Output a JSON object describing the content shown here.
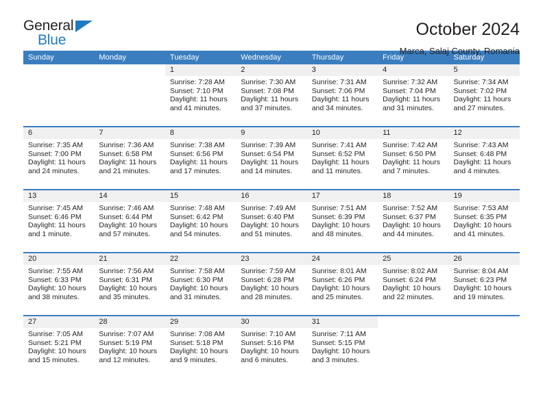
{
  "logo": {
    "word_one": "General",
    "word_two": "Blue",
    "triangle_icon": "blue-triangle-icon",
    "blue": "#1f7ac4"
  },
  "header": {
    "title": "October 2024",
    "subtitle": "Marca, Salaj County, Romania"
  },
  "theme": {
    "accent": "#3a7ec0",
    "daynum_band": "#f0f0f0",
    "text": "#231f20"
  },
  "weekdays": [
    "Sunday",
    "Monday",
    "Tuesday",
    "Wednesday",
    "Thursday",
    "Friday",
    "Saturday"
  ],
  "labels": {
    "sunrise_prefix": "Sunrise:",
    "sunset_prefix": "Sunset:",
    "daylight_prefix": "Daylight:"
  },
  "weeks": [
    [
      {
        "day": "",
        "blank": true
      },
      {
        "day": "",
        "blank": true
      },
      {
        "day": "1",
        "sunrise": "Sunrise: 7:28 AM",
        "sunset": "Sunset: 7:10 PM",
        "daylight_1": "Daylight: 11 hours",
        "daylight_2": "and 41 minutes."
      },
      {
        "day": "2",
        "sunrise": "Sunrise: 7:30 AM",
        "sunset": "Sunset: 7:08 PM",
        "daylight_1": "Daylight: 11 hours",
        "daylight_2": "and 37 minutes."
      },
      {
        "day": "3",
        "sunrise": "Sunrise: 7:31 AM",
        "sunset": "Sunset: 7:06 PM",
        "daylight_1": "Daylight: 11 hours",
        "daylight_2": "and 34 minutes."
      },
      {
        "day": "4",
        "sunrise": "Sunrise: 7:32 AM",
        "sunset": "Sunset: 7:04 PM",
        "daylight_1": "Daylight: 11 hours",
        "daylight_2": "and 31 minutes."
      },
      {
        "day": "5",
        "sunrise": "Sunrise: 7:34 AM",
        "sunset": "Sunset: 7:02 PM",
        "daylight_1": "Daylight: 11 hours",
        "daylight_2": "and 27 minutes."
      }
    ],
    [
      {
        "day": "6",
        "sunrise": "Sunrise: 7:35 AM",
        "sunset": "Sunset: 7:00 PM",
        "daylight_1": "Daylight: 11 hours",
        "daylight_2": "and 24 minutes."
      },
      {
        "day": "7",
        "sunrise": "Sunrise: 7:36 AM",
        "sunset": "Sunset: 6:58 PM",
        "daylight_1": "Daylight: 11 hours",
        "daylight_2": "and 21 minutes."
      },
      {
        "day": "8",
        "sunrise": "Sunrise: 7:38 AM",
        "sunset": "Sunset: 6:56 PM",
        "daylight_1": "Daylight: 11 hours",
        "daylight_2": "and 17 minutes."
      },
      {
        "day": "9",
        "sunrise": "Sunrise: 7:39 AM",
        "sunset": "Sunset: 6:54 PM",
        "daylight_1": "Daylight: 11 hours",
        "daylight_2": "and 14 minutes."
      },
      {
        "day": "10",
        "sunrise": "Sunrise: 7:41 AM",
        "sunset": "Sunset: 6:52 PM",
        "daylight_1": "Daylight: 11 hours",
        "daylight_2": "and 11 minutes."
      },
      {
        "day": "11",
        "sunrise": "Sunrise: 7:42 AM",
        "sunset": "Sunset: 6:50 PM",
        "daylight_1": "Daylight: 11 hours",
        "daylight_2": "and 7 minutes."
      },
      {
        "day": "12",
        "sunrise": "Sunrise: 7:43 AM",
        "sunset": "Sunset: 6:48 PM",
        "daylight_1": "Daylight: 11 hours",
        "daylight_2": "and 4 minutes."
      }
    ],
    [
      {
        "day": "13",
        "sunrise": "Sunrise: 7:45 AM",
        "sunset": "Sunset: 6:46 PM",
        "daylight_1": "Daylight: 11 hours",
        "daylight_2": "and 1 minute."
      },
      {
        "day": "14",
        "sunrise": "Sunrise: 7:46 AM",
        "sunset": "Sunset: 6:44 PM",
        "daylight_1": "Daylight: 10 hours",
        "daylight_2": "and 57 minutes."
      },
      {
        "day": "15",
        "sunrise": "Sunrise: 7:48 AM",
        "sunset": "Sunset: 6:42 PM",
        "daylight_1": "Daylight: 10 hours",
        "daylight_2": "and 54 minutes."
      },
      {
        "day": "16",
        "sunrise": "Sunrise: 7:49 AM",
        "sunset": "Sunset: 6:40 PM",
        "daylight_1": "Daylight: 10 hours",
        "daylight_2": "and 51 minutes."
      },
      {
        "day": "17",
        "sunrise": "Sunrise: 7:51 AM",
        "sunset": "Sunset: 6:39 PM",
        "daylight_1": "Daylight: 10 hours",
        "daylight_2": "and 48 minutes."
      },
      {
        "day": "18",
        "sunrise": "Sunrise: 7:52 AM",
        "sunset": "Sunset: 6:37 PM",
        "daylight_1": "Daylight: 10 hours",
        "daylight_2": "and 44 minutes."
      },
      {
        "day": "19",
        "sunrise": "Sunrise: 7:53 AM",
        "sunset": "Sunset: 6:35 PM",
        "daylight_1": "Daylight: 10 hours",
        "daylight_2": "and 41 minutes."
      }
    ],
    [
      {
        "day": "20",
        "sunrise": "Sunrise: 7:55 AM",
        "sunset": "Sunset: 6:33 PM",
        "daylight_1": "Daylight: 10 hours",
        "daylight_2": "and 38 minutes."
      },
      {
        "day": "21",
        "sunrise": "Sunrise: 7:56 AM",
        "sunset": "Sunset: 6:31 PM",
        "daylight_1": "Daylight: 10 hours",
        "daylight_2": "and 35 minutes."
      },
      {
        "day": "22",
        "sunrise": "Sunrise: 7:58 AM",
        "sunset": "Sunset: 6:30 PM",
        "daylight_1": "Daylight: 10 hours",
        "daylight_2": "and 31 minutes."
      },
      {
        "day": "23",
        "sunrise": "Sunrise: 7:59 AM",
        "sunset": "Sunset: 6:28 PM",
        "daylight_1": "Daylight: 10 hours",
        "daylight_2": "and 28 minutes."
      },
      {
        "day": "24",
        "sunrise": "Sunrise: 8:01 AM",
        "sunset": "Sunset: 6:26 PM",
        "daylight_1": "Daylight: 10 hours",
        "daylight_2": "and 25 minutes."
      },
      {
        "day": "25",
        "sunrise": "Sunrise: 8:02 AM",
        "sunset": "Sunset: 6:24 PM",
        "daylight_1": "Daylight: 10 hours",
        "daylight_2": "and 22 minutes."
      },
      {
        "day": "26",
        "sunrise": "Sunrise: 8:04 AM",
        "sunset": "Sunset: 6:23 PM",
        "daylight_1": "Daylight: 10 hours",
        "daylight_2": "and 19 minutes."
      }
    ],
    [
      {
        "day": "27",
        "sunrise": "Sunrise: 7:05 AM",
        "sunset": "Sunset: 5:21 PM",
        "daylight_1": "Daylight: 10 hours",
        "daylight_2": "and 15 minutes."
      },
      {
        "day": "28",
        "sunrise": "Sunrise: 7:07 AM",
        "sunset": "Sunset: 5:19 PM",
        "daylight_1": "Daylight: 10 hours",
        "daylight_2": "and 12 minutes."
      },
      {
        "day": "29",
        "sunrise": "Sunrise: 7:08 AM",
        "sunset": "Sunset: 5:18 PM",
        "daylight_1": "Daylight: 10 hours",
        "daylight_2": "and 9 minutes."
      },
      {
        "day": "30",
        "sunrise": "Sunrise: 7:10 AM",
        "sunset": "Sunset: 5:16 PM",
        "daylight_1": "Daylight: 10 hours",
        "daylight_2": "and 6 minutes."
      },
      {
        "day": "31",
        "sunrise": "Sunrise: 7:11 AM",
        "sunset": "Sunset: 5:15 PM",
        "daylight_1": "Daylight: 10 hours",
        "daylight_2": "and 3 minutes."
      },
      {
        "day": "",
        "blank": true
      },
      {
        "day": "",
        "blank": true
      }
    ]
  ]
}
